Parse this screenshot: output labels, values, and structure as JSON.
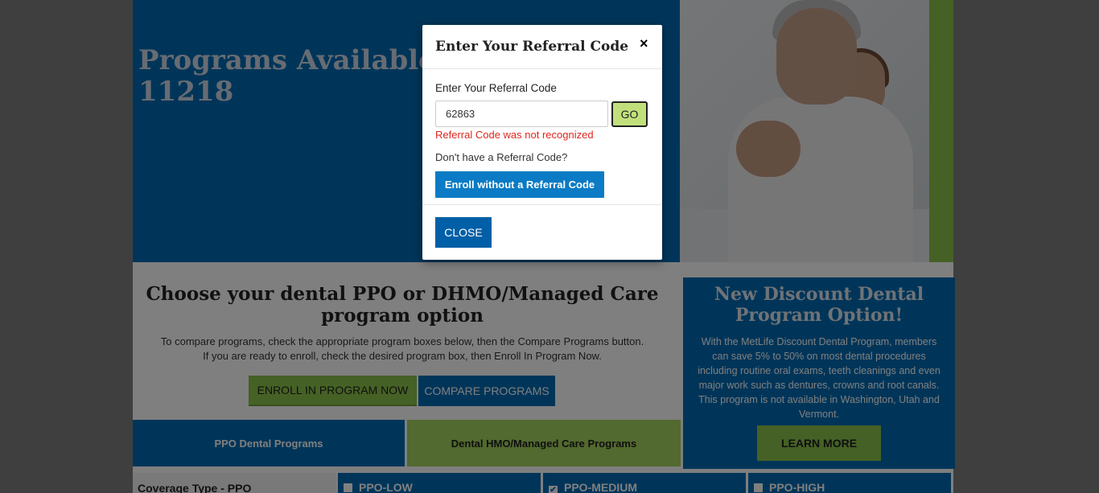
{
  "hero": {
    "title": "Programs Available in 11218"
  },
  "programs": {
    "title": "Choose your dental PPO or DHMO/Managed Care program option",
    "desc_line1": "To compare programs, check the appropriate program boxes below, then the Compare Programs button.",
    "desc_line2": "If you are ready to enroll, check the desired program box, then Enroll In Program Now.",
    "enroll_now_label": "ENROLL IN PROGRAM NOW",
    "compare_label": "COMPARE PROGRAMS",
    "tab_ppo": "PPO Dental Programs",
    "tab_dhmo": "Dental HMO/Managed Care Programs"
  },
  "discount": {
    "title": "New Discount Dental Program Option!",
    "text": "With the MetLife Discount Dental Program, members can save 5% to 50% on most dental procedures including routine oral exams, teeth cleanings and even major work such as dentures, crowns and root canals. This program is not available in Washington, Utah and Vermont.",
    "learn_more": "LEARN MORE"
  },
  "coverage": {
    "label": "Coverage Type - PPO",
    "columns": [
      {
        "name": "PPO-LOW",
        "checked": false
      },
      {
        "name": "PPO-MEDIUM",
        "checked": true
      },
      {
        "name": "PPO-HIGH",
        "checked": false
      }
    ]
  },
  "modal": {
    "title": "Enter Your Referral Code",
    "close_x": "×",
    "field_label": "Enter Your Referral Code",
    "code_value": "62863",
    "go_label": "GO",
    "error": "Referral Code was not recognized",
    "no_code_text": "Don't have a Referral Code?",
    "enroll_without": "Enroll without a Referral Code",
    "close_label": "CLOSE"
  },
  "colors": {
    "primary_blue": "#006ab3",
    "accent_green": "#8bc34a",
    "error_red": "#e0261e"
  }
}
